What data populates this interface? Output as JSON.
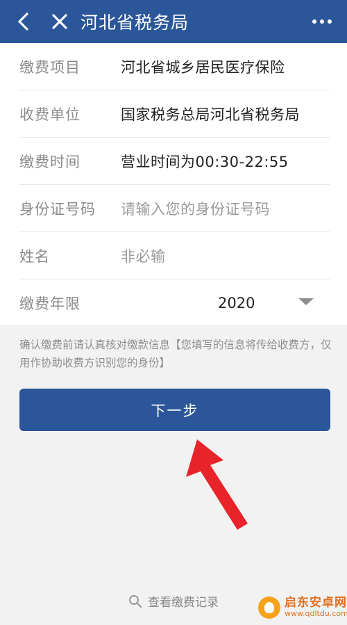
{
  "header": {
    "title": "河北省税务局"
  },
  "form": {
    "rows": [
      {
        "label": "缴费项目",
        "value": "河北省城乡居民医疗保险"
      },
      {
        "label": "收费单位",
        "value": "国家税务总局河北省税务局"
      },
      {
        "label": "缴费时间",
        "value": "营业时间为00:30-22:55"
      },
      {
        "label": "身份证号码",
        "placeholder": "请输入您的身份证号码"
      },
      {
        "label": "姓名",
        "placeholder": "非必输"
      },
      {
        "label": "缴费年限",
        "value": "2020"
      }
    ]
  },
  "notice": "确认缴费前请认真核对缴款信息【您填写的信息将传给收费方，仅用作协助收费方识别您的身份】",
  "next_button": "下一步",
  "records_link": "查看缴费记录",
  "watermark": {
    "cn": "启东安卓网",
    "en": "www.qdltdu.com"
  },
  "colors": {
    "brand": "#2b579a",
    "annotation_arrow": "#e8242a"
  }
}
